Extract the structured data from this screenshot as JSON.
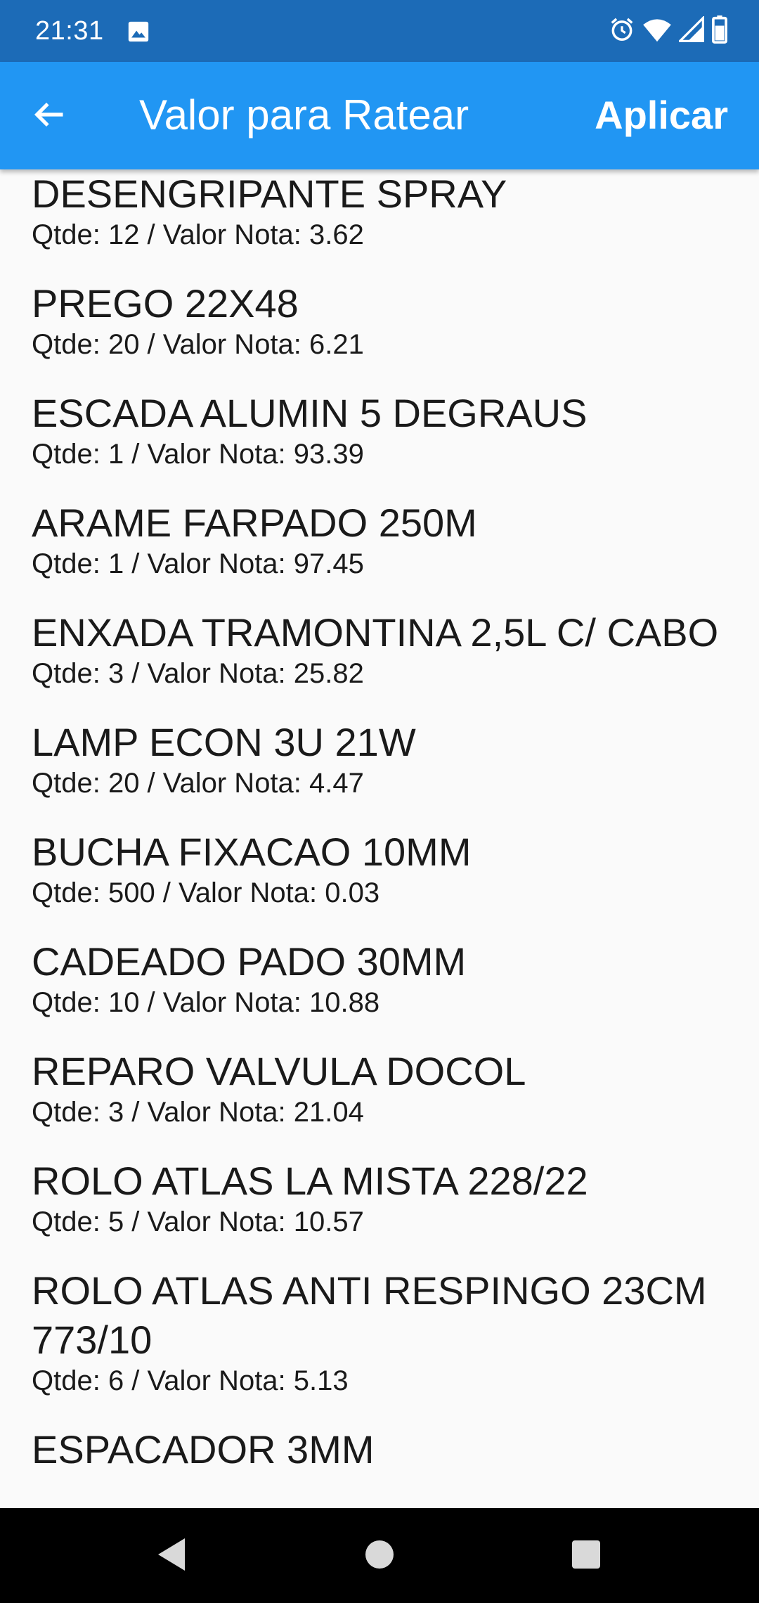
{
  "status_bar": {
    "time": "21:31",
    "left_icons": [
      "image-icon"
    ],
    "right_icons": [
      "alarm-icon",
      "wifi-icon",
      "signal-icon",
      "battery-icon"
    ]
  },
  "app_bar": {
    "title": "Valor para Ratear",
    "action_label": "Aplicar",
    "back_icon": "arrow-back-icon"
  },
  "colors": {
    "status_bar": "#1c6bb7",
    "app_bar": "#2196f3",
    "background": "#fafafa",
    "text": "#1a1a1a"
  },
  "items": [
    {
      "name": "DESENGRIPANTE SPRAY",
      "detail": "Qtde: 12 / Valor Nota: 3.62"
    },
    {
      "name": "PREGO 22X48",
      "detail": "Qtde: 20 / Valor Nota: 6.21"
    },
    {
      "name": "ESCADA ALUMIN 5 DEGRAUS",
      "detail": "Qtde: 1 / Valor Nota: 93.39"
    },
    {
      "name": "ARAME FARPADO 250M",
      "detail": "Qtde: 1 / Valor Nota: 97.45"
    },
    {
      "name": "ENXADA TRAMONTINA 2,5L C/ CABO",
      "detail": "Qtde: 3 / Valor Nota: 25.82"
    },
    {
      "name": "LAMP ECON 3U 21W",
      "detail": "Qtde: 20 / Valor Nota: 4.47"
    },
    {
      "name": "BUCHA FIXACAO 10MM",
      "detail": "Qtde: 500 / Valor Nota: 0.03"
    },
    {
      "name": "CADEADO PADO 30MM",
      "detail": "Qtde: 10 / Valor Nota: 10.88"
    },
    {
      "name": "REPARO VALVULA DOCOL",
      "detail": "Qtde: 3 / Valor Nota: 21.04"
    },
    {
      "name": "ROLO ATLAS LA MISTA 228/22",
      "detail": "Qtde: 5 / Valor Nota: 10.57"
    },
    {
      "name": "ROLO ATLAS ANTI RESPINGO 23CM 773/10",
      "detail": "Qtde: 6 / Valor Nota: 5.13"
    },
    {
      "name": "ESPACADOR 3MM",
      "detail": ""
    }
  ],
  "nav_bar": {
    "buttons": [
      "back-triangle-icon",
      "home-circle-icon",
      "recents-square-icon"
    ]
  }
}
